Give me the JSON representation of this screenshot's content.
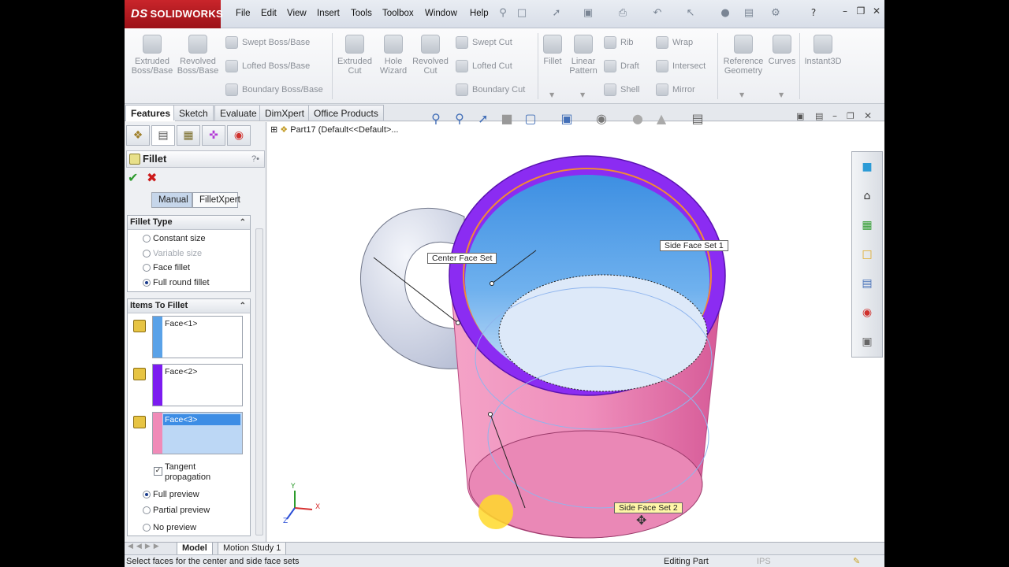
{
  "app": {
    "logo_text": "SOLIDWORKS",
    "logo_prefix": "DS"
  },
  "menu": {
    "items": [
      "File",
      "Edit",
      "View",
      "Insert",
      "Tools",
      "Toolbox",
      "Window",
      "Help"
    ]
  },
  "ribbon": {
    "extruded_boss": "Extruded Boss/Base",
    "revolved_boss": "Revolved Boss/Base",
    "swept_boss": "Swept Boss/Base",
    "lofted_boss": "Lofted Boss/Base",
    "boundary_boss": "Boundary Boss/Base",
    "extruded_cut": "Extruded Cut",
    "hole_wizard": "Hole Wizard",
    "revolved_cut": "Revolved Cut",
    "swept_cut": "Swept Cut",
    "lofted_cut": "Lofted Cut",
    "boundary_cut": "Boundary Cut",
    "fillet": "Fillet",
    "linear_pattern": "Linear Pattern",
    "rib": "Rib",
    "draft": "Draft",
    "shell": "Shell",
    "wrap": "Wrap",
    "intersect": "Intersect",
    "mirror": "Mirror",
    "reference_geometry": "Reference Geometry",
    "curves": "Curves",
    "instant3d": "Instant3D"
  },
  "tabs": [
    "Features",
    "Sketch",
    "Evaluate",
    "DimXpert",
    "Office Products"
  ],
  "property_manager": {
    "title": "Fillet",
    "modes": [
      "Manual",
      "FilletXpert"
    ],
    "fillet_type": {
      "header": "Fillet Type",
      "options": [
        "Constant size",
        "Variable size",
        "Face fillet",
        "Full round fillet"
      ],
      "selected": "Full round fillet"
    },
    "items_to_fillet": {
      "header": "Items To Fillet",
      "faces": [
        "Face<1>",
        "Face<2>",
        "Face<3>"
      ],
      "face_colors": [
        "#5aa2e8",
        "#7c1cf0",
        "#f08bb8"
      ],
      "tangent_propagation": "Tangent propagation",
      "preview_options": [
        "Full preview",
        "Partial preview",
        "No preview"
      ],
      "preview_selected": "Full preview"
    }
  },
  "graphics": {
    "tree_root": "Part17  (Default<<Default>...",
    "callouts": {
      "center": "Center Face Set",
      "side1": "Side Face Set 1",
      "side2": "Side Face Set 2"
    },
    "triad_x": "X",
    "triad_y": "Y",
    "triad_z": "Z"
  },
  "bottom_tabs": [
    "Model",
    "Motion Study 1"
  ],
  "status": {
    "message": "Select faces for the center and side face sets",
    "mode": "Editing Part",
    "units": "IPS"
  },
  "colors": {
    "brand": "#c9252b",
    "side_set_1": "#5aa2e8",
    "side_set_2": "#f08bb8",
    "center_set": "#7c1cf0"
  }
}
